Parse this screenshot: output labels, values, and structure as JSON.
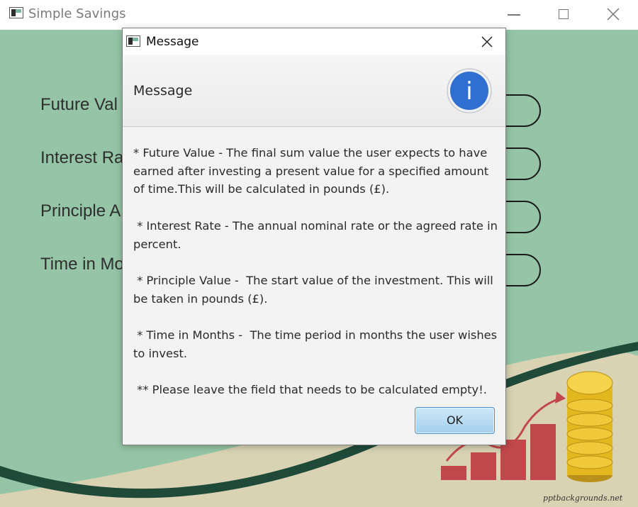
{
  "window": {
    "title": "Simple Savings",
    "icon": "app-icon",
    "controls": [
      "minimize-icon",
      "maximize-icon",
      "close-icon"
    ]
  },
  "form": {
    "labels": [
      "Future Val",
      "Interest Ra",
      "Principle A",
      "Time in Mo"
    ]
  },
  "background": {
    "watermark": "pptbackgrounds.net",
    "colors": {
      "green": "#95c5a6",
      "beige": "#d9d3b4",
      "swoosh": "#1f4a3a",
      "bars": "#c0484a",
      "coins": "#e3b81e"
    }
  },
  "dialog": {
    "title": "Message",
    "header": "Message",
    "icon": "info-icon",
    "info_glyph": "i",
    "body": [
      "* Future Value - The final sum value the user expects to have earned after investing a present value for a specified amount of time.This will be calculated in pounds (£).",
      " * Interest Rate - The annual nominal rate or the agreed rate in percent.",
      " * Principle Value -  The start value of the investment. This will be taken in pounds (£).",
      " * Time in Months -  The time period in months the user wishes to invest.",
      " ** Please leave the field that needs to be calculated empty!."
    ],
    "ok_label": "OK",
    "colors": {
      "ok_border": "#4a90c2",
      "info_blue": "#2f6fd1"
    }
  }
}
